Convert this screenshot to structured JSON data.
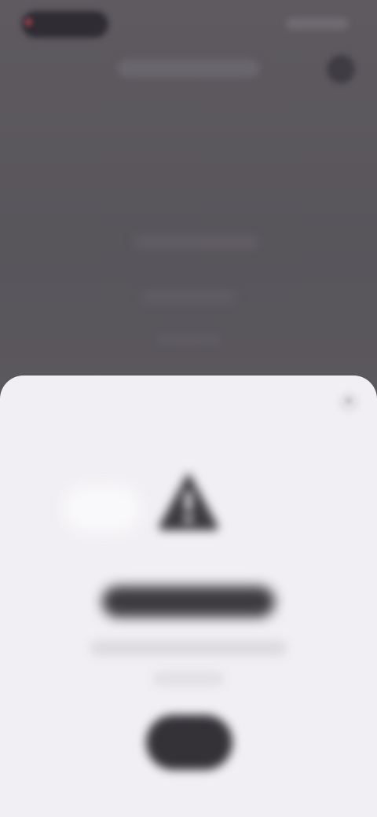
{
  "status_bar": {
    "time": "",
    "indicators": ""
  },
  "top_bar": {
    "title": "",
    "action_icon": "more-icon"
  },
  "sheet": {
    "close_icon": "close-icon",
    "hero_icon": "warning-triangle-icon",
    "title": "",
    "subtitle": "",
    "primary_button_label": ""
  },
  "colors": {
    "backdrop": "#5b575e",
    "sheet_background": "#f1eff3",
    "title_text": "#3e3b40",
    "button": "#343137"
  }
}
